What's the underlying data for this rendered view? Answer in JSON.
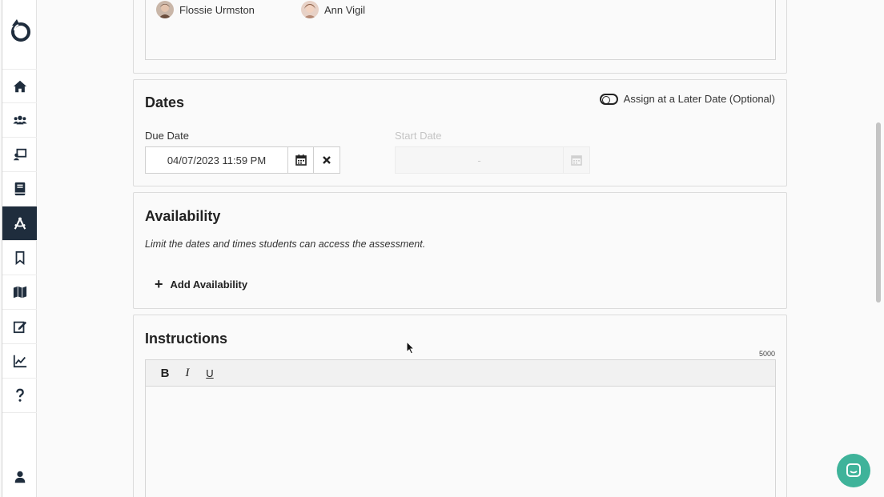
{
  "sidebar": {
    "items": [
      {
        "name": "home",
        "icon": "home-icon"
      },
      {
        "name": "students",
        "icon": "users-icon"
      },
      {
        "name": "classes",
        "icon": "chalkboard-teacher-icon"
      },
      {
        "name": "library",
        "icon": "book-icon"
      },
      {
        "name": "assessments",
        "icon": "drafting-compass-icon",
        "active": true
      },
      {
        "name": "bookmarks",
        "icon": "bookmark-icon"
      },
      {
        "name": "map",
        "icon": "map-icon"
      },
      {
        "name": "edit",
        "icon": "edit-icon"
      },
      {
        "name": "reports",
        "icon": "chart-line-icon"
      },
      {
        "name": "help",
        "icon": "question-icon"
      }
    ],
    "profile_icon": "user-icon"
  },
  "assignees": [
    {
      "name": "Flossie Urmston"
    },
    {
      "name": "Ann Vigil"
    }
  ],
  "dates": {
    "title": "Dates",
    "toggle_label": "Assign at a Later Date (Optional)",
    "due_label": "Due Date",
    "due_value": "04/07/2023 11:59 PM",
    "start_label": "Start Date",
    "start_value": "-"
  },
  "availability": {
    "title": "Availability",
    "note": "Limit the dates and times students can access the assessment.",
    "add_label": "Add Availability"
  },
  "instructions": {
    "title": "Instructions",
    "char_limit": "5000",
    "toolbar": {
      "bold": "B",
      "italic": "I",
      "underline": "U"
    }
  },
  "colors": {
    "active_nav": "#1f2d3d",
    "chat": "#3fb39a"
  }
}
